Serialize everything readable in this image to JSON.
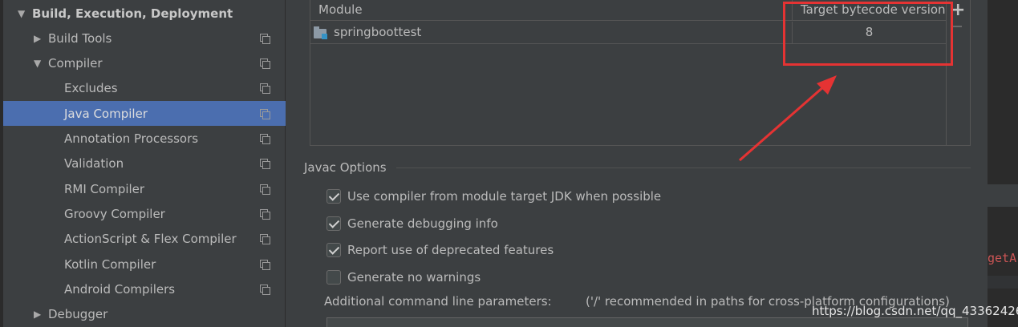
{
  "settings_tree": {
    "section_title": "Build, Execution, Deployment",
    "items": [
      {
        "label": "Build Tools",
        "expandable": true,
        "expanded": false,
        "level": 1
      },
      {
        "label": "Compiler",
        "expandable": true,
        "expanded": true,
        "level": 1
      },
      {
        "label": "Excludes",
        "level": 2
      },
      {
        "label": "Java Compiler",
        "level": 2,
        "selected": true
      },
      {
        "label": "Annotation Processors",
        "level": 2
      },
      {
        "label": "Validation",
        "level": 2
      },
      {
        "label": "RMI Compiler",
        "level": 2
      },
      {
        "label": "Groovy Compiler",
        "level": 2
      },
      {
        "label": "ActionScript & Flex Compiler",
        "level": 2
      },
      {
        "label": "Kotlin Compiler",
        "level": 2
      },
      {
        "label": "Android Compilers",
        "level": 2
      },
      {
        "label": "Debugger",
        "expandable": true,
        "expanded": false,
        "level": 1
      }
    ]
  },
  "module_table": {
    "columns": [
      "Module",
      "Target bytecode version"
    ],
    "rows": [
      {
        "module": "springboottest",
        "target_version": "8"
      }
    ],
    "add_label": "+"
  },
  "javac_options": {
    "title": "Javac Options",
    "checkboxes": [
      {
        "label": "Use compiler from module target JDK when possible",
        "checked": true
      },
      {
        "label": "Generate debugging info",
        "checked": true
      },
      {
        "label": "Report use of deprecated features",
        "checked": true
      },
      {
        "label": "Generate no warnings",
        "checked": false
      }
    ],
    "params_label": "Additional command line parameters:",
    "params_hint": "('/' recommended in paths for cross-platform configurations)",
    "params_value": ""
  },
  "editor_snippet": "getA",
  "watermark": "https://blog.csdn.net/qq_43362426",
  "colors": {
    "selection": "#4b6eaf",
    "highlight": "#e53333",
    "background": "#3c3f41"
  }
}
